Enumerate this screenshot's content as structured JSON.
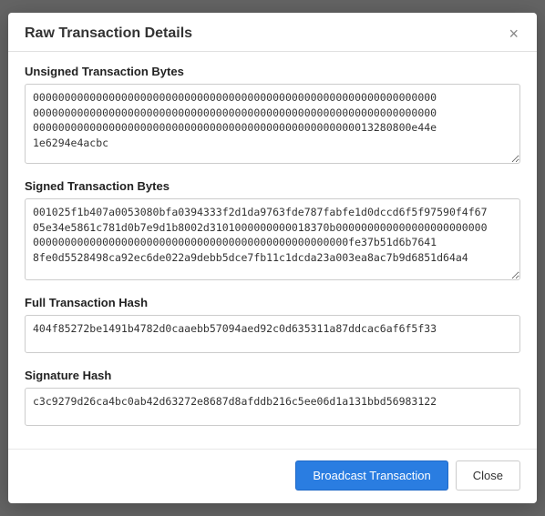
{
  "modal": {
    "title": "Raw Transaction Details",
    "close_label": "×"
  },
  "sections": {
    "unsigned_label": "Unsigned Transaction Bytes",
    "unsigned_value": "0000000000000000000000000000000000000000000000000000000000000000\n0000000000000000000000000000000000000000000000000000000000000000\n000000000000000000000000000000000000000000000000000013280800e44e\n1e6294e4acbc",
    "signed_label": "Signed Transaction Bytes",
    "signed_value": "001025f1b407a0053080bfa0394333f2d1da9763fde787fabfe1d0dccd6f5f97590f4f67\n05e34e5861c781d0b7e9d1b8002d3101000000000018370b000000000000000000000000\n00000000000000000000000000000000000000000000000000fe37b51d6b7641\n8fe0d5528498ca92ec6de022a9debb5dce7fb11c1dcda23a003ea8ac7b9d6851d64a4",
    "hash_label": "Full Transaction Hash",
    "hash_value": "404f85272be1491b4782d0caaebb57094aed92c0d635311a87ddcac6af6f5f33",
    "sig_hash_label": "Signature Hash",
    "sig_hash_value": "c3c9279d26ca4bc0ab42d63272e8687d8afddb216c5ee06d1a131bbd56983122"
  },
  "footer": {
    "broadcast_label": "Broadcast Transaction",
    "close_label": "Close"
  }
}
